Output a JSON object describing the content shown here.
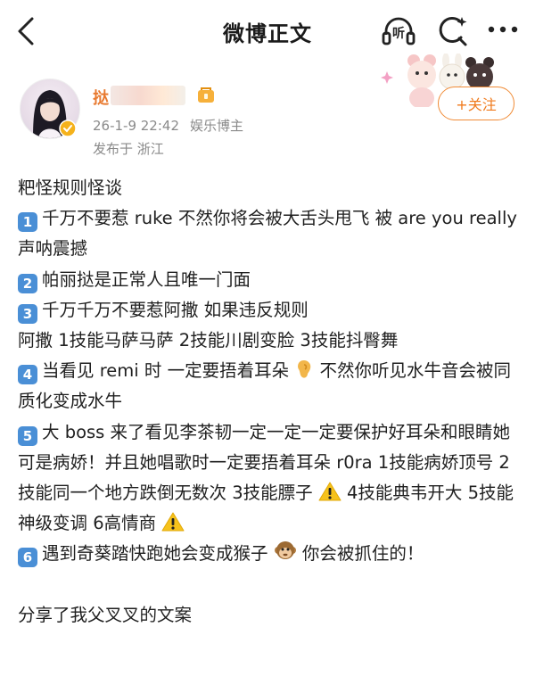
{
  "header": {
    "title": "微博正文",
    "listen_label": "听"
  },
  "post": {
    "author_name": "挞",
    "date": "26-1-9 22:42",
    "author_tag": "娱乐博主",
    "location": "发布于 浙江",
    "follow_label": "+关注",
    "intro": "粑怪规则怪谈",
    "rules": [
      {
        "num": "1",
        "text": "千万不要惹 ruke 不然你将会被大舌头甩飞 被 are you really 声呐震撼"
      },
      {
        "num": "2",
        "text": "帕丽挞是正常人且唯一门面"
      },
      {
        "num": "3",
        "text": "千万千万不要惹阿撒 如果违反规则"
      },
      {
        "num": "",
        "text": "阿撒 1技能马萨马萨 2技能川剧变脸 3技能抖臀舞"
      },
      {
        "num": "4",
        "text_a": "当看见 remi 时 一定要捂着耳朵",
        "text_b": "不然你听见水牛音会被同质化变成水牛",
        "emoji": "ear-emoji"
      },
      {
        "num": "5",
        "text_a": "大 boss 来了看见李茶韧一定一定一定要保护好耳朵和眼睛她可是病娇！并且她唱歌时一定要捂着耳朵 r0ra 1技能病娇顶号 2技能同一个地方跌倒无数次 3技能膘子",
        "text_b": "4技能典韦开大 5技能神级变调 6高情商",
        "emoji": "warning-emoji"
      },
      {
        "num": "6",
        "text_a": "遇到奇葵踏快跑她会变成猴子",
        "text_b": "你会被抓住的！",
        "emoji": "monkey-emoji"
      }
    ],
    "outro": "分享了我父叉叉的文案"
  }
}
